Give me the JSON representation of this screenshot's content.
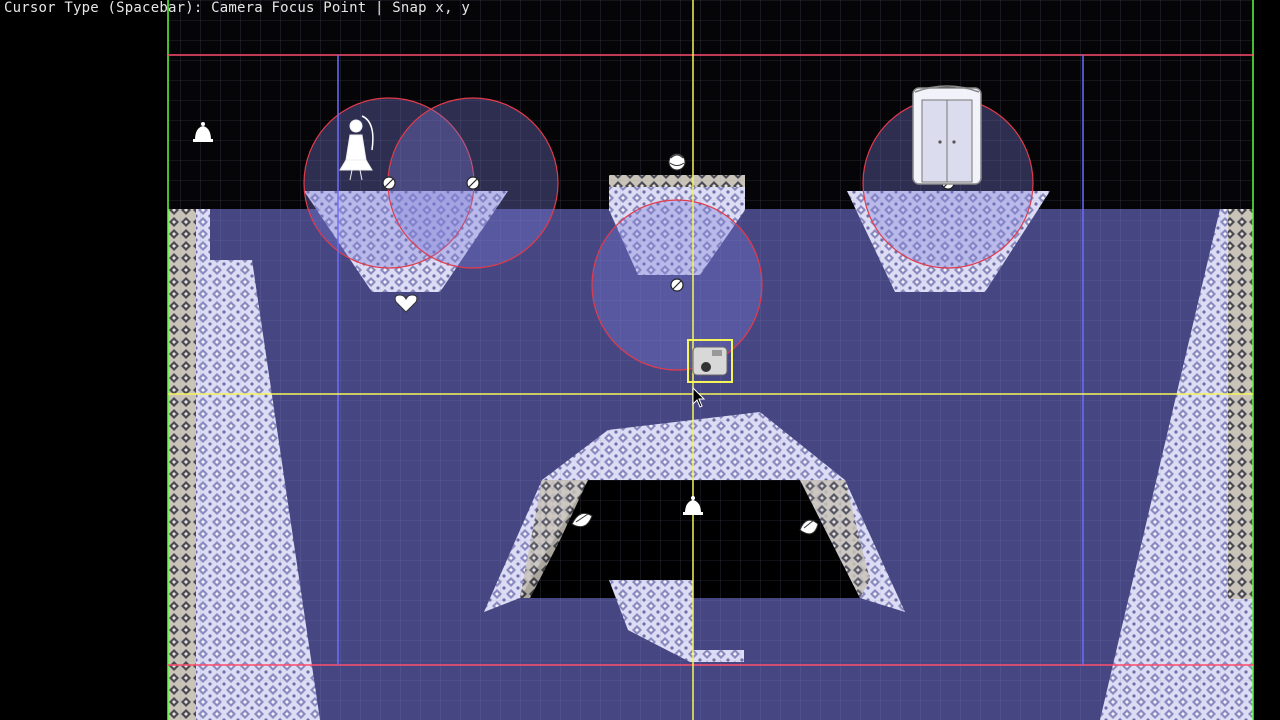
{
  "status_bar": {
    "text": "Cursor Type (Spacebar): Camera Focus Point | Snap x, y"
  },
  "editor": {
    "cursor_type": "Camera Focus Point",
    "snap": "x, y"
  },
  "colors": {
    "background": "#000000",
    "water": "#4a4a8c",
    "grid": "#6a6a9a",
    "bound_green": "#5aff3a",
    "bound_red": "#ff4d6d",
    "bound_blue": "#6d6dff",
    "crosshair": "#f5f55a",
    "radius_circle": "#e23b4b",
    "tile_fill": "#d9d9f2",
    "tile_dots": "#6e6ea8"
  },
  "objects": [
    {
      "name": "player-start-icon",
      "type": "bell"
    },
    {
      "name": "woman-figure-icon",
      "type": "npc"
    },
    {
      "name": "door-icon",
      "type": "exit-door"
    },
    {
      "name": "camera-icon",
      "type": "camera-focus-point",
      "selected": true
    },
    {
      "name": "flower-icon",
      "type": "pickup"
    },
    {
      "name": "heart-icon",
      "type": "pickup"
    },
    {
      "name": "shell-icon-left",
      "type": "pickup"
    },
    {
      "name": "shell-icon-right",
      "type": "pickup"
    },
    {
      "name": "bell-icon-center",
      "type": "bell"
    },
    {
      "name": "no-entry-icon",
      "type": "trigger"
    }
  ]
}
